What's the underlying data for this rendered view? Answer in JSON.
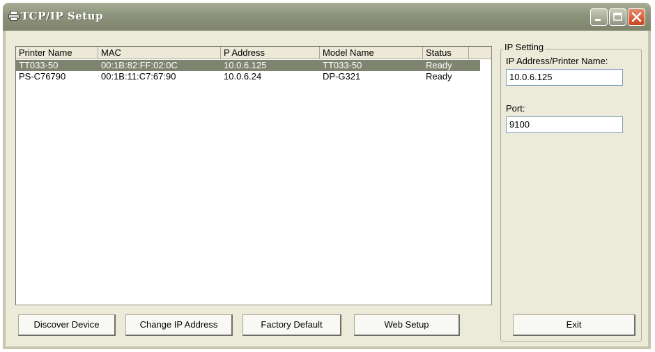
{
  "window": {
    "title": "TCP/IP Setup"
  },
  "list": {
    "columns": [
      "Printer Name",
      "MAC",
      "P Address",
      "Model Name",
      "Status"
    ],
    "rows": [
      {
        "name": "TT033-50",
        "mac": "00:1B:82:FF:02:0C",
        "ip": "10.0.6.125",
        "model": "TT033-50",
        "status": "Ready",
        "selected": true
      },
      {
        "name": "PS-C76790",
        "mac": "00:1B:11:C7:67:90",
        "ip": "10.0.6.24",
        "model": "DP-G321",
        "status": "Ready",
        "selected": false
      }
    ]
  },
  "buttons": {
    "discover": "Discover Device",
    "change_ip": "Change IP Address",
    "factory": "Factory Default",
    "web": "Web Setup",
    "exit": "Exit"
  },
  "ip_setting": {
    "group_label": "IP Setting",
    "address_label": "IP Address/Printer Name:",
    "address_value": "10.0.6.125",
    "port_label": "Port:",
    "port_value": "9100"
  },
  "icons": {
    "title": "printer-icon",
    "minimize": "minimize-icon",
    "maximize": "maximize-icon",
    "close": "close-icon"
  },
  "colors": {
    "selection": "#7f8470",
    "titlebar": "#8d937b",
    "close": "#c8431c"
  }
}
